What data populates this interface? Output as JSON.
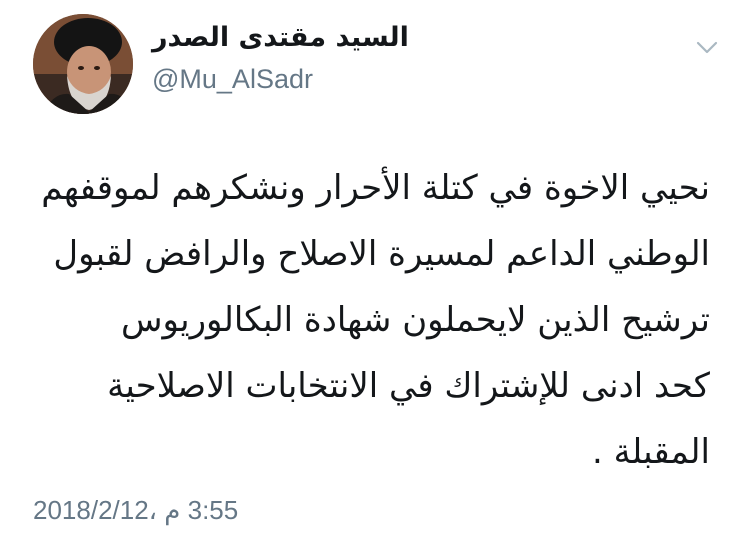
{
  "author": {
    "display_name": "السيد مقتدى الصدر",
    "handle": "@Mu_AlSadr"
  },
  "tweet": {
    "lines": [
      "نحيي الاخوة في كتلة الأحرار ونشكرهم لموقفهم",
      "الوطني الداعم لمسيرة الاصلاح والرافض لقبول",
      "ترشيح الذين لايحملون شهادة البكالوريوس",
      "كحد ادنى للإشتراك في الانتخابات الاصلاحية",
      "المقبلة ."
    ]
  },
  "meta": {
    "timestamp": "3:55 م ،2018/2/12"
  },
  "icons": {
    "menu": "chevron-down-icon",
    "avatar": "profile-photo"
  },
  "colors": {
    "text": "#14171a",
    "secondary": "#657786",
    "background": "#ffffff"
  }
}
